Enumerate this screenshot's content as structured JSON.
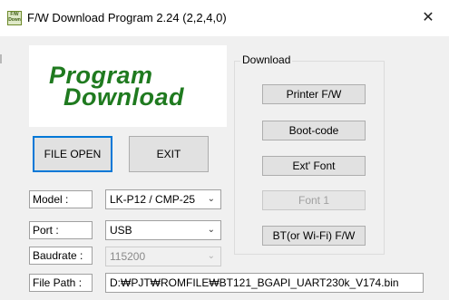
{
  "window": {
    "title": "F/W Download Program 2.24 (2,2,4,0)",
    "icon_text": "F/W Down",
    "close_glyph": "✕"
  },
  "logo": {
    "line1": "Program",
    "line2": "Download"
  },
  "buttons": {
    "file_open": "FILE OPEN",
    "exit": "EXIT"
  },
  "download": {
    "group_label": "Download",
    "printer_fw": "Printer F/W",
    "boot_code": "Boot-code",
    "ext_font": "Ext' Font",
    "font1": "Font 1",
    "bt_wifi_fw": "BT(or Wi-Fi) F/W"
  },
  "fields": {
    "model": {
      "label": "Model   :",
      "value": "LK-P12 / CMP-25"
    },
    "port": {
      "label": "Port     :",
      "value": "USB"
    },
    "baudrate": {
      "label": "Baudrate :",
      "value": "115200"
    },
    "file_path": {
      "label": "File Path :",
      "value": "D:₩PJT₩ROMFILE₩BT121_BGAPI_UART230k_V174.bin"
    }
  },
  "icons": {
    "dropdown": "chevron-down-icon",
    "close": "close-icon",
    "app": "app-icon"
  },
  "colors": {
    "logo_green": "#1f7a1f",
    "focus_blue": "#0078d7"
  }
}
